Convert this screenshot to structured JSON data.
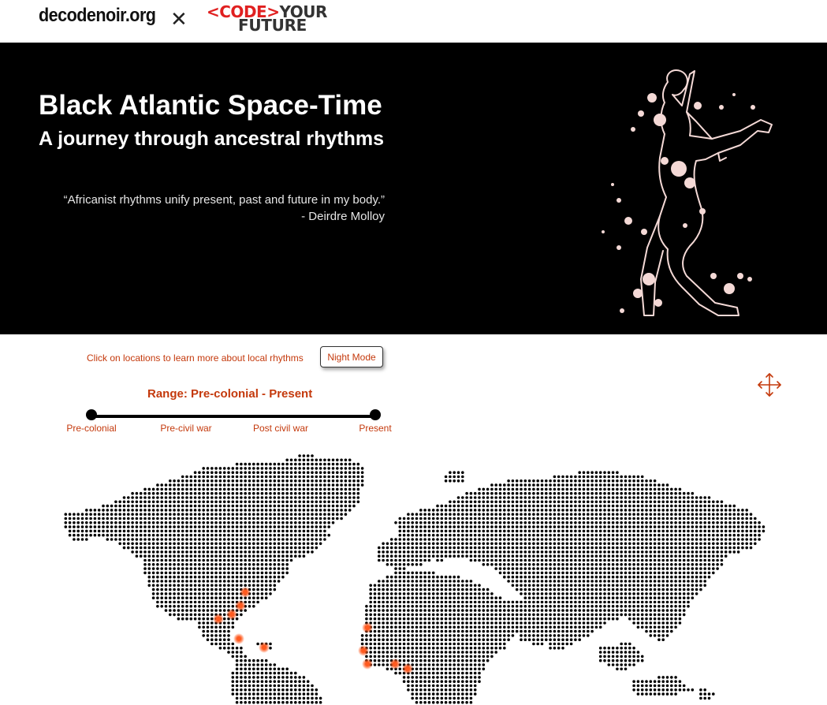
{
  "header": {
    "brand": "decodenoir.org",
    "separator": "✕",
    "partner_logo": {
      "line1_code": "<CODE>",
      "line1_your": "YOUR",
      "line2": "FUTURE"
    }
  },
  "hero": {
    "title": "Black Atlantic Space-Time",
    "subtitle": "A journey through ancestral rhythms",
    "quote": "“Africanist rhythms unify present, past and future in my body.”",
    "author": "- Deirdre Molloy"
  },
  "controls": {
    "hint": "Click on locations to learn more about local rhythms",
    "night_mode_label": "Night Mode",
    "range_title": "Range: Pre-colonial - Present",
    "ticks": [
      "Pre-colonial",
      "Pre-civil war",
      "Post civil war",
      "Present"
    ],
    "range_start": "Pre-colonial",
    "range_end": "Present"
  },
  "map": {
    "icons": [
      "move-icon"
    ],
    "marker_color": "#ff5a1f",
    "accent_color": "#c4390c"
  }
}
